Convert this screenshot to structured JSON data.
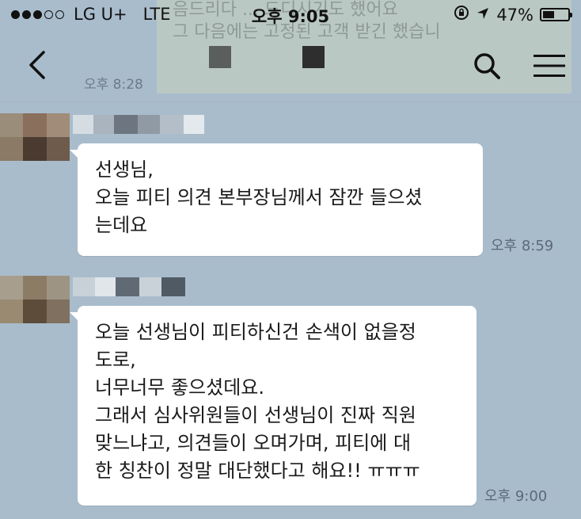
{
  "status_bar": {
    "carrier": "LG U+",
    "network": "LTE",
    "time": "오후 9:05",
    "battery": "47%",
    "battery_level": 0.47
  },
  "banner": {
    "text_line1": "음드리다 ... 드디시기도 했어요",
    "text_line2": "그 다음에는 고정된 고객 받긴 했습니"
  },
  "nav": {
    "previous_message_time": "오후 8:28"
  },
  "messages": [
    {
      "lines": [
        "선생님,",
        "오늘 피티 의견 본부장님께서 잠깐 들으셨",
        "는데요"
      ],
      "time": "오후 8:59"
    },
    {
      "lines": [
        "오늘 선생님이 피티하신건 손색이 없을정",
        "도로,",
        "너무너무 좋으셨데요.",
        "그래서 심사위원들이 선생님이 진짜 직원",
        "맞느냐고, 의견들이 오며가며, 피티에 대",
        "한 칭찬이 정말 대단했다고 해요!! ㅠㅠㅠ"
      ],
      "time": "오후 9:00"
    }
  ],
  "colors": {
    "chat_background": "#a9bccc",
    "bubble": "#ffffff",
    "text": "#1a1a1a"
  }
}
